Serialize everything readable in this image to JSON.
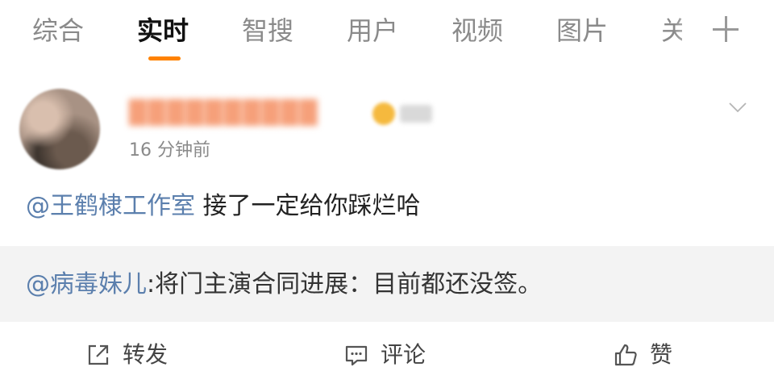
{
  "tabs": {
    "items": [
      {
        "label": "综合"
      },
      {
        "label": "实时"
      },
      {
        "label": "智搜"
      },
      {
        "label": "用户"
      },
      {
        "label": "视频"
      },
      {
        "label": "图片"
      },
      {
        "label": "关"
      }
    ],
    "active_index": 1,
    "add_icon": "plus-icon",
    "indicator_color": "#ff8200"
  },
  "post": {
    "author": {
      "avatar_icon": "user-avatar",
      "name": "██████████",
      "badge_icon": "verified-badge-icon"
    },
    "time": "16 分钟前",
    "menu_icon": "chevron-down-icon",
    "mention": "@王鹤棣工作室",
    "text": " 接了一定给你踩烂哈",
    "repost": {
      "mention": "@病毒妹儿",
      "text": ":将门主演合同进展：目前都还没签。"
    }
  },
  "actions": {
    "repost": {
      "label": "转发",
      "icon": "share-icon"
    },
    "comment": {
      "label": "评论",
      "icon": "comment-icon"
    },
    "like": {
      "label": "赞",
      "icon": "thumb-up-icon"
    }
  },
  "colors": {
    "link": "#5b7fad",
    "muted": "#8a8a8a",
    "repost_bg": "#f3f3f3"
  }
}
